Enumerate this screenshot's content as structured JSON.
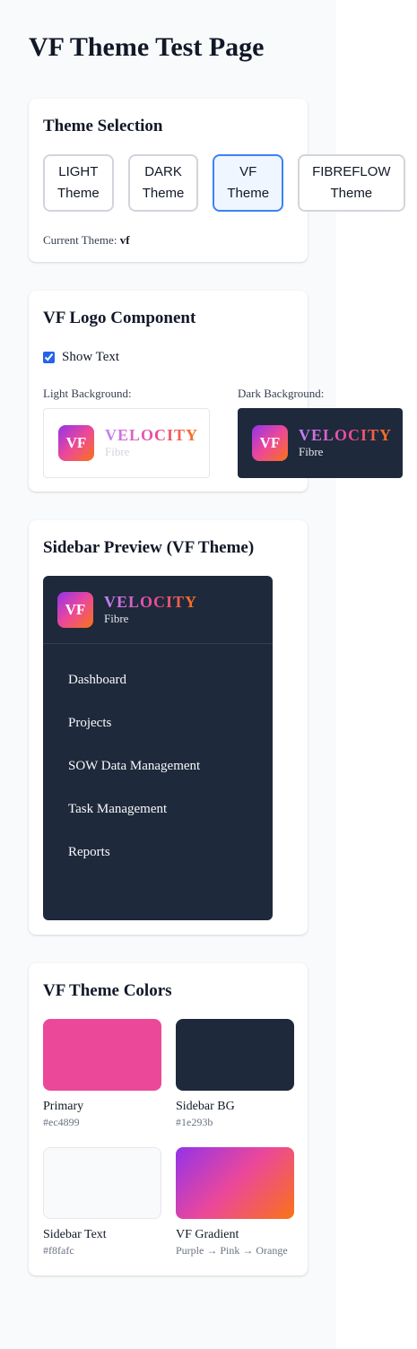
{
  "page": {
    "title": "VF Theme Test Page"
  },
  "theme_selection": {
    "heading": "Theme Selection",
    "buttons": [
      {
        "line1": "LIGHT",
        "line2": "Theme"
      },
      {
        "line1": "DARK",
        "line2": "Theme"
      },
      {
        "line1": "VF",
        "line2": "Theme"
      },
      {
        "line1": "FIBREFLOW",
        "line2": "Theme"
      }
    ],
    "active_index": 2,
    "current_label": "Current Theme:",
    "current_value": "vf"
  },
  "logo_component": {
    "heading": "VF Logo Component",
    "show_text_label": "Show Text",
    "show_text_checked": true,
    "light_label": "Light Background:",
    "dark_label": "Dark Background:",
    "mark": "VF",
    "name": "VELOCITY",
    "sub": "Fibre"
  },
  "sidebar_preview": {
    "heading": "Sidebar Preview (VF Theme)",
    "nav_items": [
      "Dashboard",
      "Projects",
      "SOW Data Management",
      "Task Management",
      "Reports"
    ]
  },
  "theme_colors": {
    "heading": "VF Theme Colors",
    "swatches": [
      {
        "name": "Primary",
        "value": "#ec4899",
        "color": "#ec4899"
      },
      {
        "name": "Sidebar BG",
        "value": "#1e293b",
        "color": "#1e293b"
      },
      {
        "name": "Sidebar Text",
        "value": "#f8fafc",
        "color": "#f8fafc"
      },
      {
        "name": "VF Gradient",
        "value": "Purple → Pink → Orange",
        "color": "#9333ea,#ec4899,#f97316"
      }
    ]
  }
}
